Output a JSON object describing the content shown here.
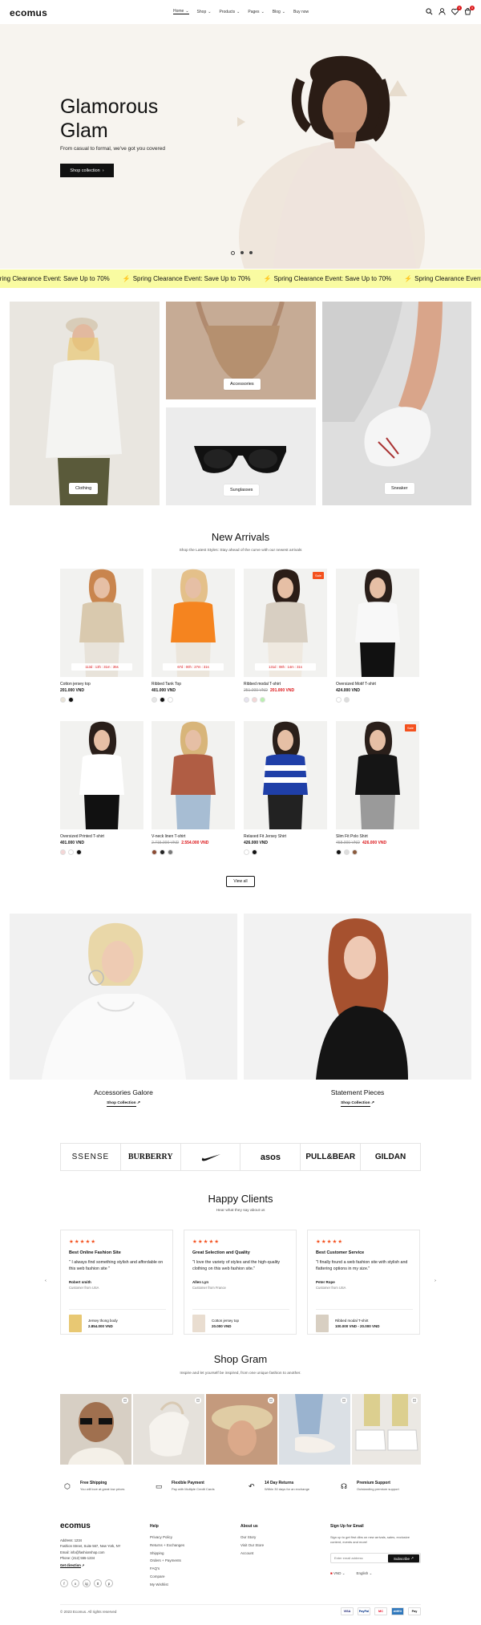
{
  "header": {
    "logo": "ecomus",
    "nav": [
      {
        "label": "Home",
        "active": true,
        "caret": true
      },
      {
        "label": "Shop",
        "caret": true
      },
      {
        "label": "Products",
        "caret": true
      },
      {
        "label": "Pages",
        "caret": true
      },
      {
        "label": "Blog",
        "caret": true
      },
      {
        "label": "Buy now",
        "caret": false
      }
    ],
    "wishlist_count": "0",
    "cart_count": "0"
  },
  "hero": {
    "title_line1": "Glamorous",
    "title_line2": "Glam",
    "subtitle": "From casual to formal, we've got you covered",
    "button": "Shop collection"
  },
  "marquee": {
    "text": "Spring Clearance Event: Save Up to 70%"
  },
  "categories": [
    {
      "label": "Clothing"
    },
    {
      "label": "Accessories"
    },
    {
      "label": "Sunglasses"
    },
    {
      "label": "Sneaker"
    }
  ],
  "new_arrivals": {
    "title": "New Arrivals",
    "subtitle": "Shop the Latest Styles: Stay ahead of the curve with our newest arrivals",
    "products": [
      {
        "name": "Cotton jersey top",
        "price": "201.000 VND",
        "old_price": "",
        "sale": false,
        "countdown": "113d : 13h : 31m : 35s",
        "swatches": [
          "#e8e2d6",
          "#111111"
        ]
      },
      {
        "name": "Ribbed Tank Top",
        "price": "401.000 VND",
        "old_price": "",
        "sale": false,
        "countdown": "67d : 00h : 27m : 31s",
        "swatches": [
          "#e6e6e6",
          "#111111",
          "#ffffff"
        ]
      },
      {
        "name": "Ribbed modal T-shirt",
        "price": "201.000 VND",
        "old_price": "251.000 VND",
        "sale": true,
        "sale_label": "Sale",
        "countdown": "131d : 08h : 14m : 31s",
        "swatches": [
          "#e6e3ef",
          "#f4d6d6",
          "#b9f0b0"
        ]
      },
      {
        "name": "Oversized Motif T-shirt",
        "price": "424.000 VND",
        "old_price": "",
        "sale": false,
        "countdown": "",
        "swatches": [
          "#ffffff",
          "#dddddd"
        ]
      },
      {
        "name": "Oversized Printed T-shirt",
        "price": "401.000 VND",
        "old_price": "",
        "sale": false,
        "countdown": "",
        "swatches": [
          "#f4d6d6",
          "#ffffff",
          "#111111"
        ]
      },
      {
        "name": "V-neck linen T-shirt",
        "price": "2.554.000 VND",
        "old_price": "2.715.000 VND",
        "sale": false,
        "countdown": "",
        "swatches": [
          "#8b4a32",
          "#222222",
          "#777777"
        ]
      },
      {
        "name": "Relaxed Fit Jersey Shirt",
        "price": "426.000 VND",
        "old_price": "",
        "sale": false,
        "countdown": "",
        "swatches": [
          "#ffffff",
          "#111111"
        ]
      },
      {
        "name": "Slim Fit Polo Shirt",
        "price": "426.000 VND",
        "old_price": "458.000 VND",
        "sale": true,
        "sale_label": "Sale",
        "countdown": "",
        "swatches": [
          "#111111",
          "#dddddd",
          "#8b5a3c"
        ]
      }
    ],
    "view_all": "View all"
  },
  "collections": [
    {
      "title": "Accessories Galore",
      "link": "Shop Collection"
    },
    {
      "title": "Statement Pieces",
      "link": "Shop Collection"
    }
  ],
  "brands": [
    "SSENSE",
    "BURBERRY",
    "nike-swoosh",
    "asos",
    "PULL&BEAR",
    "GILDAN"
  ],
  "testimonials": {
    "title": "Happy Clients",
    "subtitle": "Hear what they say about us",
    "items": [
      {
        "stars": "★★★★★",
        "heading": "Best Online Fashion Site",
        "body": "\" I always find something stylish and affordable on this web fashion site \"",
        "name": "Robert smith",
        "location": "Customer from USA",
        "product": "Jersey thong body",
        "price": "2.854.000 VND"
      },
      {
        "stars": "★★★★★",
        "heading": "Great Selection and Quality",
        "body": "\"I love the variety of styles and the high-quality clothing on this web fashion site.\"",
        "name": "Allen Lyn",
        "location": "Customer from France",
        "product": "Cotton jersey top",
        "price": "20.000 VND"
      },
      {
        "stars": "★★★★★",
        "heading": "Best Customer Service",
        "body": "\"I finally found a web fashion site with stylish and flattering options in my size.\"",
        "name": "Peter Rope",
        "location": "Customer from USA",
        "product": "Ribbed modal T-shirt",
        "price": "100.000 VND - 20.000 VND"
      }
    ]
  },
  "gram": {
    "title": "Shop Gram",
    "subtitle": "Inspire and let yourself be inspired, from one unique fashion to another."
  },
  "features": [
    {
      "title": "Free Shipping",
      "text": "You will love at great low prices",
      "icon": "box-icon"
    },
    {
      "title": "Flexible Payment",
      "text": "Pay with Multiple Credit Cards",
      "icon": "card-icon"
    },
    {
      "title": "14 Day Returns",
      "text": "Within 30 days for an exchange",
      "icon": "return-icon"
    },
    {
      "title": "Premium Support",
      "text": "Outstanding premium support",
      "icon": "support-icon"
    }
  ],
  "footer": {
    "logo": "ecomus",
    "address_line1": "Address: 1234",
    "address_line2": "Fashion Street, Suite 567, New York, NY",
    "email": "Email: info@fashionshop.com",
    "phone": "Phone: (212) 555-1234",
    "directions": "Get direction",
    "help_title": "Help",
    "help": [
      "Privacy Policy",
      "Returns + Exchanges",
      "Shipping",
      "Orders + Payments",
      "FAQ's",
      "Compare",
      "My Wishlist"
    ],
    "about_title": "About us",
    "about": [
      "Our Story",
      "Visit Our Store",
      "Account"
    ],
    "signup_title": "Sign Up for Email",
    "signup_text": "Sign up to get first dibs on new arrivals, sales, exclusive content, events and more!",
    "email_placeholder": "Enter email address",
    "subscribe": "Subscribe",
    "currency": "VND",
    "language": "English",
    "copyright": "© 2023 Ecomus. All rights reserved",
    "payments": [
      "VISA",
      "PayPal",
      "MC",
      "AMEX",
      "Pay"
    ],
    "socials": [
      "f",
      "x",
      "ig",
      "tt",
      "p"
    ]
  },
  "colors": {
    "accent": "#db1215",
    "sale": "#f4511e",
    "marquee_bg": "#f9fba1",
    "hero_bg": "#f7f4ef"
  }
}
